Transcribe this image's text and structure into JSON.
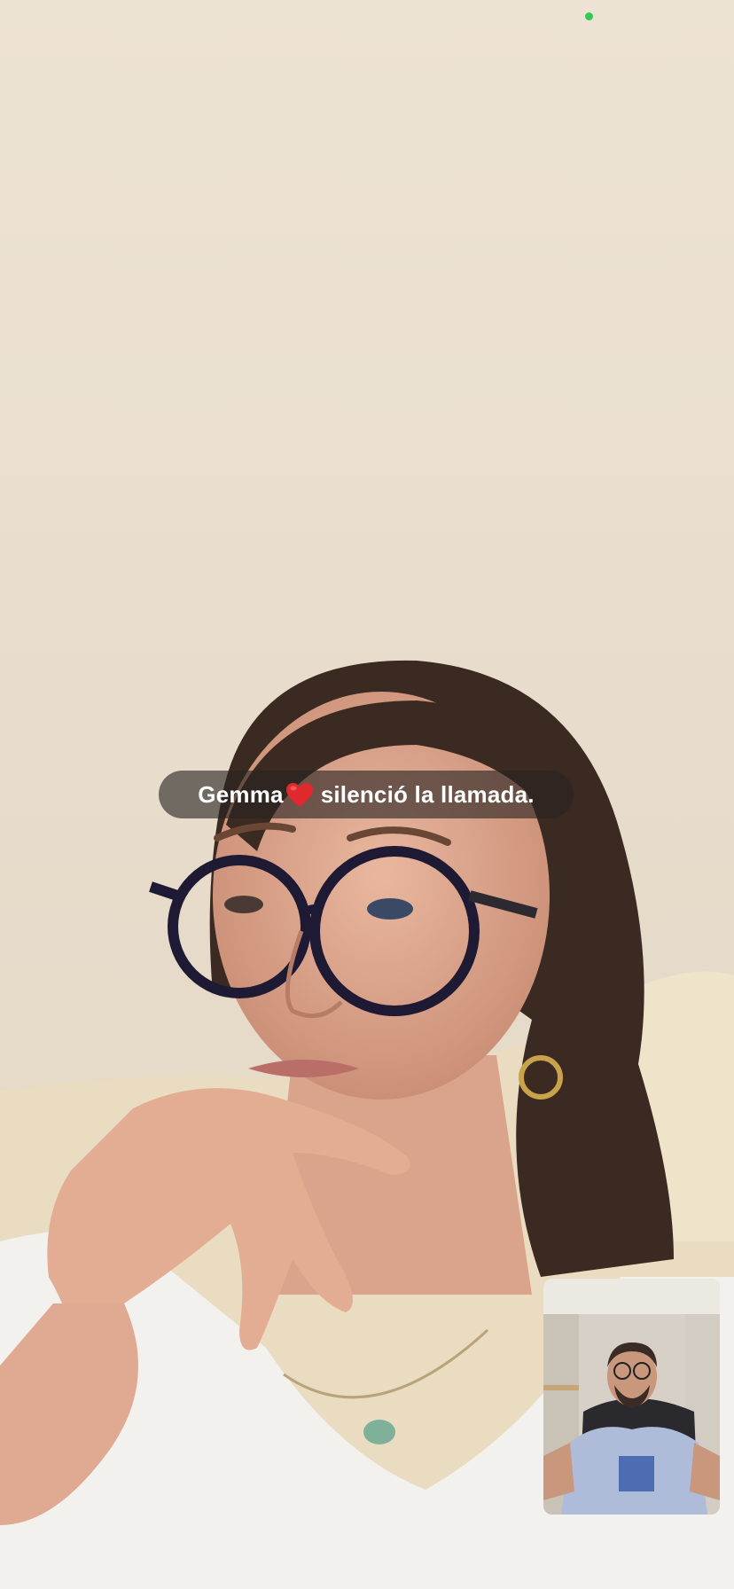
{
  "call": {
    "status_banner": {
      "caller_name": "Gemma",
      "heart_emoji": "❤️",
      "message": "silenció la llamada."
    },
    "privacy_indicator_color": "#34c759",
    "remote_video": {
      "description_icon": "remote-participant-video"
    },
    "self_view": {
      "description_icon": "self-camera-preview"
    }
  }
}
